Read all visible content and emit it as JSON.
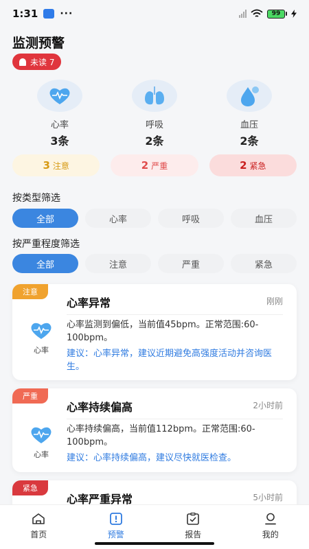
{
  "status_bar": {
    "time": "1:31",
    "dots": "···",
    "battery": "99"
  },
  "page": {
    "title": "监测预警",
    "unread_label": "未读 7"
  },
  "metrics": [
    {
      "name": "心率",
      "count": "3条",
      "icon": "heart-icon"
    },
    {
      "name": "呼吸",
      "count": "2条",
      "icon": "lungs-icon"
    },
    {
      "name": "血压",
      "count": "2条",
      "icon": "blood-drop-icon"
    }
  ],
  "severity_summary": [
    {
      "num": "3",
      "label": "注意"
    },
    {
      "num": "2",
      "label": "严重"
    },
    {
      "num": "2",
      "label": "紧急"
    }
  ],
  "filters": {
    "type_label": "按类型筛选",
    "type_options": [
      "全部",
      "心率",
      "呼吸",
      "血压"
    ],
    "severity_label": "按严重程度筛选",
    "severity_options": [
      "全部",
      "注意",
      "严重",
      "紧急"
    ]
  },
  "alerts": [
    {
      "tag": "注意",
      "title": "心率异常",
      "time": "刚刚",
      "category": "心率",
      "desc": "心率监测到偏低，当前值45bpm。正常范围:60-100bpm。",
      "advice": "建议：心率异常，建议近期避免高强度活动并咨询医生。"
    },
    {
      "tag": "严重",
      "title": "心率持续偏高",
      "time": "2小时前",
      "category": "心率",
      "desc": "心率持续偏高，当前值112bpm。正常范围:60-100bpm。",
      "advice": "建议：心率持续偏高，建议尽快就医检查。"
    },
    {
      "tag": "紧急",
      "title": "心率严重异常",
      "time": "5小时前"
    }
  ],
  "tabbar": [
    {
      "label": "首页",
      "icon": "home-icon"
    },
    {
      "label": "预警",
      "icon": "alert-icon"
    },
    {
      "label": "报告",
      "icon": "report-icon"
    },
    {
      "label": "我的",
      "icon": "profile-icon"
    }
  ],
  "colors": {
    "accent": "#3b86e0",
    "attention": "#f0a22e",
    "severe": "#f06a54",
    "urgent": "#d9393e"
  }
}
